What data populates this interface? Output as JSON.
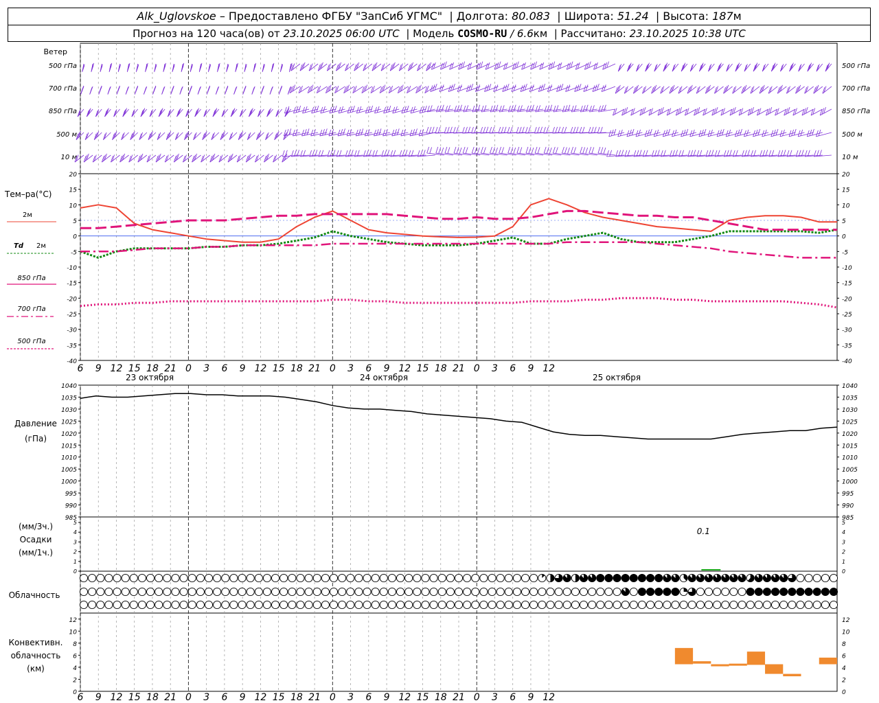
{
  "header": {
    "station": "Alk_Uglovskoe",
    "provided": "– Предоставлено ФГБУ \"ЗапСиб УГМС\"",
    "lon_label": "Долгота:",
    "lon": "80.083",
    "lat_label": "Широта:",
    "lat": "51.24",
    "alt_label": "Высота:",
    "alt": "187",
    "alt_unit": "м",
    "forecast_label": "Прогноз на 120 часа(ов) от",
    "forecast_time": "23.10.2025 06:00 UTC",
    "model_label": "Модель",
    "model": "COSMO-RU",
    "resolution": "/ 6.6",
    "res_unit": "км",
    "calc_label": "Рассчитано:",
    "calc_time": "23.10.2025 10:38 UTC"
  },
  "wind": {
    "title": "Ветер",
    "levels": [
      "500 гПа",
      "700 гПа",
      "850 гПа",
      "500 м",
      "10  м"
    ],
    "color": "#7b2bd6"
  },
  "time_axis": {
    "hour_labels": [
      "6",
      "9",
      "12",
      "15",
      "18",
      "21",
      "0",
      "3",
      "6",
      "9",
      "12",
      "15",
      "18",
      "21",
      "0",
      "3",
      "6",
      "9",
      "12",
      "15",
      "18",
      "21",
      "0",
      "3",
      "6",
      "9",
      "12"
    ],
    "day_labels": [
      "23 октября",
      "24 октября",
      "25 октября"
    ]
  },
  "labels": {
    "temp_title": "Тем–ра(°C)",
    "t2m": "2м",
    "td": "Td",
    "td2m": "2м",
    "p850": "850 гПа",
    "p700": "700 гПа",
    "p500": "500 гПа",
    "pressure_title": "Давление",
    "pressure_unit": "(гПа)",
    "precip_unit3": "(мм/3ч.)",
    "precip_title": "Осадки",
    "precip_unit1": "(мм/1ч.)",
    "precip_value_label": "0.1",
    "cloud_title": "Облачность",
    "conv_title1": "Конвективн.",
    "conv_title2": "облачность",
    "conv_unit": "(км)"
  },
  "chart_data": [
    {
      "type": "line",
      "panel": "temperature",
      "ylim": [
        -40,
        20
      ],
      "yticks": [
        "20",
        "15",
        "10",
        "5",
        "0",
        "-5",
        "-10",
        "-15",
        "-20",
        "-25",
        "-30",
        "-35",
        "-40"
      ],
      "x_hours": [
        0,
        3,
        6,
        9,
        12,
        15,
        18,
        21,
        24,
        27,
        30,
        33,
        36,
        39,
        42,
        45,
        48,
        51,
        54,
        57,
        60,
        63,
        66,
        69,
        72,
        75,
        78,
        81,
        84,
        87,
        90,
        93,
        96,
        99,
        102,
        105,
        108,
        111,
        114,
        117,
        120,
        123,
        126
      ],
      "series": [
        {
          "name": "2м",
          "color": "#ee4433",
          "style": "solid",
          "values": [
            9,
            10,
            9,
            4,
            2,
            1,
            0,
            -1,
            -1.5,
            -2,
            -2,
            -1,
            3,
            6,
            8,
            5,
            2,
            1,
            0.5,
            0,
            -0.3,
            -0.5,
            -0.4,
            0,
            3,
            10,
            12,
            10,
            7.5,
            6,
            5,
            4,
            3,
            2.5,
            2,
            1.5,
            5,
            6,
            6.5,
            6.5,
            6,
            4.5,
            4.5
          ]
        },
        {
          "name": "Td 2м",
          "color": "#118811",
          "style": "dotted",
          "values": [
            -5,
            -7,
            -5,
            -4,
            -4,
            -4,
            -4,
            -3.5,
            -3.5,
            -3,
            -3,
            -2.5,
            -1.5,
            -0.5,
            1.5,
            0,
            -1,
            -2,
            -2.5,
            -3,
            -3,
            -3,
            -2.5,
            -1.5,
            -0.5,
            -2.5,
            -2.5,
            -1,
            0,
            1,
            -1,
            -2,
            -2,
            -2,
            -1,
            0,
            1.5,
            1.5,
            1.5,
            1.5,
            1.5,
            1,
            2
          ]
        },
        {
          "name": "850 гПа",
          "color": "#e0147a",
          "style": "dashed",
          "values": [
            2.5,
            2.5,
            3,
            3.5,
            4,
            4.5,
            5,
            5,
            5,
            5.5,
            6,
            6.5,
            6.5,
            7,
            7,
            7,
            7,
            7,
            6.5,
            6,
            5.5,
            5.5,
            6,
            5.5,
            5.5,
            6,
            7,
            8,
            8,
            7.5,
            7,
            6.5,
            6.5,
            6,
            6,
            5,
            4,
            3,
            2,
            2,
            2,
            2,
            2
          ]
        },
        {
          "name": "700 гПа",
          "color": "#e0147a",
          "style": "dashdot",
          "values": [
            -5,
            -5,
            -5,
            -4.5,
            -4,
            -4,
            -4,
            -3.5,
            -3.5,
            -3,
            -3,
            -3,
            -3,
            -3,
            -2.5,
            -2.5,
            -2.5,
            -2.5,
            -2.5,
            -2.5,
            -2.5,
            -2.5,
            -2.5,
            -2.5,
            -2.5,
            -2.5,
            -2.5,
            -2,
            -2,
            -2,
            -2,
            -2,
            -2.5,
            -3,
            -3.5,
            -4,
            -5,
            -5.5,
            -6,
            -6.5,
            -7,
            -7,
            -7
          ]
        },
        {
          "name": "500 гПа",
          "color": "#e0147a",
          "style": "dotted",
          "values": [
            -22.5,
            -22,
            -22,
            -21.5,
            -21.5,
            -21,
            -21,
            -21,
            -21,
            -21,
            -21,
            -21,
            -21,
            -21,
            -20.5,
            -20.5,
            -21,
            -21,
            -21.5,
            -21.5,
            -21.5,
            -21.5,
            -21.5,
            -21.5,
            -21.5,
            -21,
            -21,
            -21,
            -20.5,
            -20.5,
            -20,
            -20,
            -20,
            -20.5,
            -20.5,
            -21,
            -21,
            -21,
            -21,
            -21,
            -21.5,
            -22,
            -23
          ]
        }
      ]
    },
    {
      "type": "line",
      "panel": "pressure",
      "ylim": [
        985,
        1040
      ],
      "yticks": [
        "1040",
        "1035",
        "1030",
        "1025",
        "1020",
        "1015",
        "1010",
        "1005",
        "1000",
        "995",
        "990",
        "985"
      ],
      "x_hours": [
        0,
        3,
        6,
        9,
        12,
        15,
        18,
        21,
        24,
        27,
        30,
        33,
        36,
        39,
        42,
        45,
        48,
        51,
        54,
        57,
        60,
        63,
        66,
        69,
        72,
        75,
        78,
        81,
        84,
        87,
        90,
        93,
        96,
        99,
        102,
        105,
        108,
        111,
        114,
        117,
        120,
        123,
        126
      ],
      "series": [
        {
          "name": "Давление",
          "color": "#000000",
          "values": [
            1034.5,
            1035.5,
            1035,
            1035,
            1035.5,
            1036,
            1036.5,
            1036.5,
            1036,
            1036,
            1035.5,
            1035.5,
            1035.5,
            1035,
            1034,
            1033,
            1031.5,
            1030.5,
            1030,
            1030,
            1029.5,
            1029,
            1028,
            1027.5,
            1027,
            1026.5,
            1026,
            1025,
            1024.5,
            1022.5,
            1020.5,
            1019.5,
            1019,
            1019,
            1018.5,
            1018,
            1017.5,
            1017.5,
            1017.5,
            1017.5,
            1017.5,
            1018.5,
            1019.5,
            1020,
            1020.5,
            1021,
            1021,
            1022,
            1022.5
          ]
        }
      ]
    },
    {
      "type": "bar",
      "panel": "precipitation",
      "ylim": [
        0,
        5
      ],
      "yticks": [
        "5",
        "4",
        "3",
        "2",
        "1",
        "0"
      ],
      "x_hours": [
        105
      ],
      "values": [
        0.1
      ],
      "color": "#22aa22"
    },
    {
      "type": "bar",
      "panel": "convective_cloud",
      "ylim": [
        0,
        13
      ],
      "yticks": [
        "12",
        "10",
        "8",
        "6",
        "4",
        "2",
        "0"
      ],
      "segments_hours": [
        [
          99,
          102
        ],
        [
          102,
          105
        ],
        [
          105,
          108
        ],
        [
          108,
          111
        ],
        [
          111,
          114
        ],
        [
          114,
          117
        ],
        [
          117,
          120
        ],
        [
          123,
          126
        ]
      ],
      "bottom_km": [
        4.5,
        4.6,
        4.4,
        4.3,
        4.4,
        4.5,
        2.5,
        4.5
      ],
      "top_km": [
        7.2,
        5.0,
        4.5,
        4.6,
        6.6,
        2.9,
        2.9,
        5.6
      ],
      "color": "#f08a2e"
    },
    {
      "type": "table",
      "panel": "cloudiness",
      "rows": [
        "upper",
        "middle",
        "lower"
      ],
      "note": "octa symbols per 1-hour step",
      "upper": "000000000000000000000000000000000000000000000000000000000000000000000000041416747778888888888877637777777777577777640000000",
      "middle": "000000000000000000000000000000000000000000000000000000000000000000000000000000000000000000000000000000005700888888872600000000008888888888888888888",
      "lower": "000000000000000000000000000000000000000000000000000000000000000000000000000000000000000000000000000000000000000000000000000000000000000000000000500000"
    }
  ]
}
